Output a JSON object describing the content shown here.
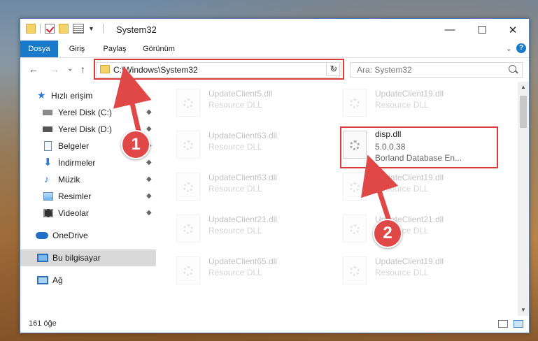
{
  "window": {
    "title": "System32",
    "title_sep": "|"
  },
  "controls": {
    "minimize": "—",
    "maximize": "☐",
    "close": "✕"
  },
  "ribbon": {
    "tabs": [
      "Dosya",
      "Giriş",
      "Paylaş",
      "Görünüm"
    ],
    "active_tab": "Dosya",
    "expand_glyph": "⌄",
    "help_glyph": "?"
  },
  "nav": {
    "back": "←",
    "forward": "→",
    "recent": "⌄",
    "up": "↑",
    "refresh": "↻"
  },
  "address": {
    "path": "C:\\Windows\\System32",
    "dropdown": "⌄"
  },
  "search": {
    "placeholder": "Ara: System32"
  },
  "sidebar": {
    "items": [
      {
        "label": "Hızlı erişim",
        "pinned": false
      },
      {
        "label": "Yerel Disk (C:)",
        "pinned": true
      },
      {
        "label": "Yerel Disk (D:)",
        "pinned": true
      },
      {
        "label": "Belgeler",
        "pinned": true
      },
      {
        "label": "İndirmeler",
        "pinned": true
      },
      {
        "label": "Müzik",
        "pinned": true
      },
      {
        "label": "Resimler",
        "pinned": true
      },
      {
        "label": "Videolar",
        "pinned": true
      },
      {
        "label": "OneDrive",
        "pinned": false
      },
      {
        "label": "Bu bilgisayar",
        "pinned": false,
        "selected": true
      },
      {
        "label": "Ağ",
        "pinned": false
      }
    ],
    "pin_glyph": "📌"
  },
  "files": [
    {
      "name": "UpdateClient5.dll",
      "type": "Resource DLL",
      "faded": true
    },
    {
      "name": "UpdateClient19.dll",
      "type": "Resource DLL",
      "faded": true
    },
    {
      "name": "UpdateClient63.dll",
      "type": "Resource DLL",
      "faded": true
    },
    {
      "name": "disp.dll",
      "version": "5.0.0.38",
      "type": "Borland Database En...",
      "faded": false,
      "highlighted": true
    },
    {
      "name": "UpdateClient63.dll",
      "type": "Resource DLL",
      "faded": true
    },
    {
      "name": "UpdateClient19.dll",
      "type": "Resource DLL",
      "faded": true
    },
    {
      "name": "UpdateClient21.dll",
      "type": "Resource DLL",
      "faded": true
    },
    {
      "name": "UpdateClient21.dll",
      "type": "Resource DLL",
      "faded": true
    },
    {
      "name": "UpdateClient65.dll",
      "type": "Resource DLL",
      "faded": true
    },
    {
      "name": "UpdateClient19.dll",
      "type": "Resource DLL",
      "faded": true
    }
  ],
  "status": {
    "item_count": "161 öğe"
  },
  "annotations": {
    "step1": "1",
    "step2": "2",
    "highlight_color": "#d93a3a"
  }
}
